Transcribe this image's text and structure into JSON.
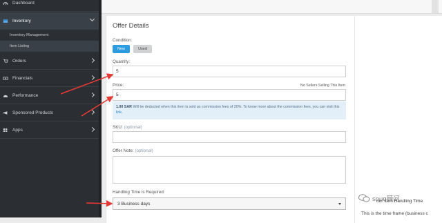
{
  "sidebar": {
    "items": [
      {
        "label": "Dashboard"
      },
      {
        "label": "Inventory"
      },
      {
        "label": "Orders"
      },
      {
        "label": "Financials"
      },
      {
        "label": "Performance"
      },
      {
        "label": "Sponsored Products"
      },
      {
        "label": "Apps"
      }
    ],
    "subitems": [
      {
        "label": "Inventory Management"
      },
      {
        "label": "Item Listing"
      }
    ]
  },
  "form": {
    "title": "Offer Details",
    "condition_label": "Condition:",
    "new_label": "New",
    "used_label": "Used",
    "quantity_label": "Quantity:",
    "quantity_value": "5",
    "price_label": "Price:",
    "price_value": "5",
    "no_sellers": "No Sellers Selling This Item",
    "info_amount": "1.00 SAR",
    "info_text": " Will be deducted when this item is sold as commission fees of 20%. To know more about the commission fees, you can visit this ",
    "info_link": "link.",
    "sku_label": "SKU:",
    "sku_optional": "(optional)",
    "note_label": "Offer Note:",
    "note_optional": "(optional)",
    "handling_label": "Handling Time is Required:",
    "handling_value": "3 Business days"
  },
  "right_panel": {
    "title": "our Item Handling Time",
    "text": "This is the time frame (business c"
  },
  "watermark": "souq顾问",
  "colors": {
    "sidebar_bg": "#2b2f33",
    "primary_button": "#2d9be0",
    "annotation_arrow": "#e53935",
    "info_bg": "#e2eef8"
  }
}
